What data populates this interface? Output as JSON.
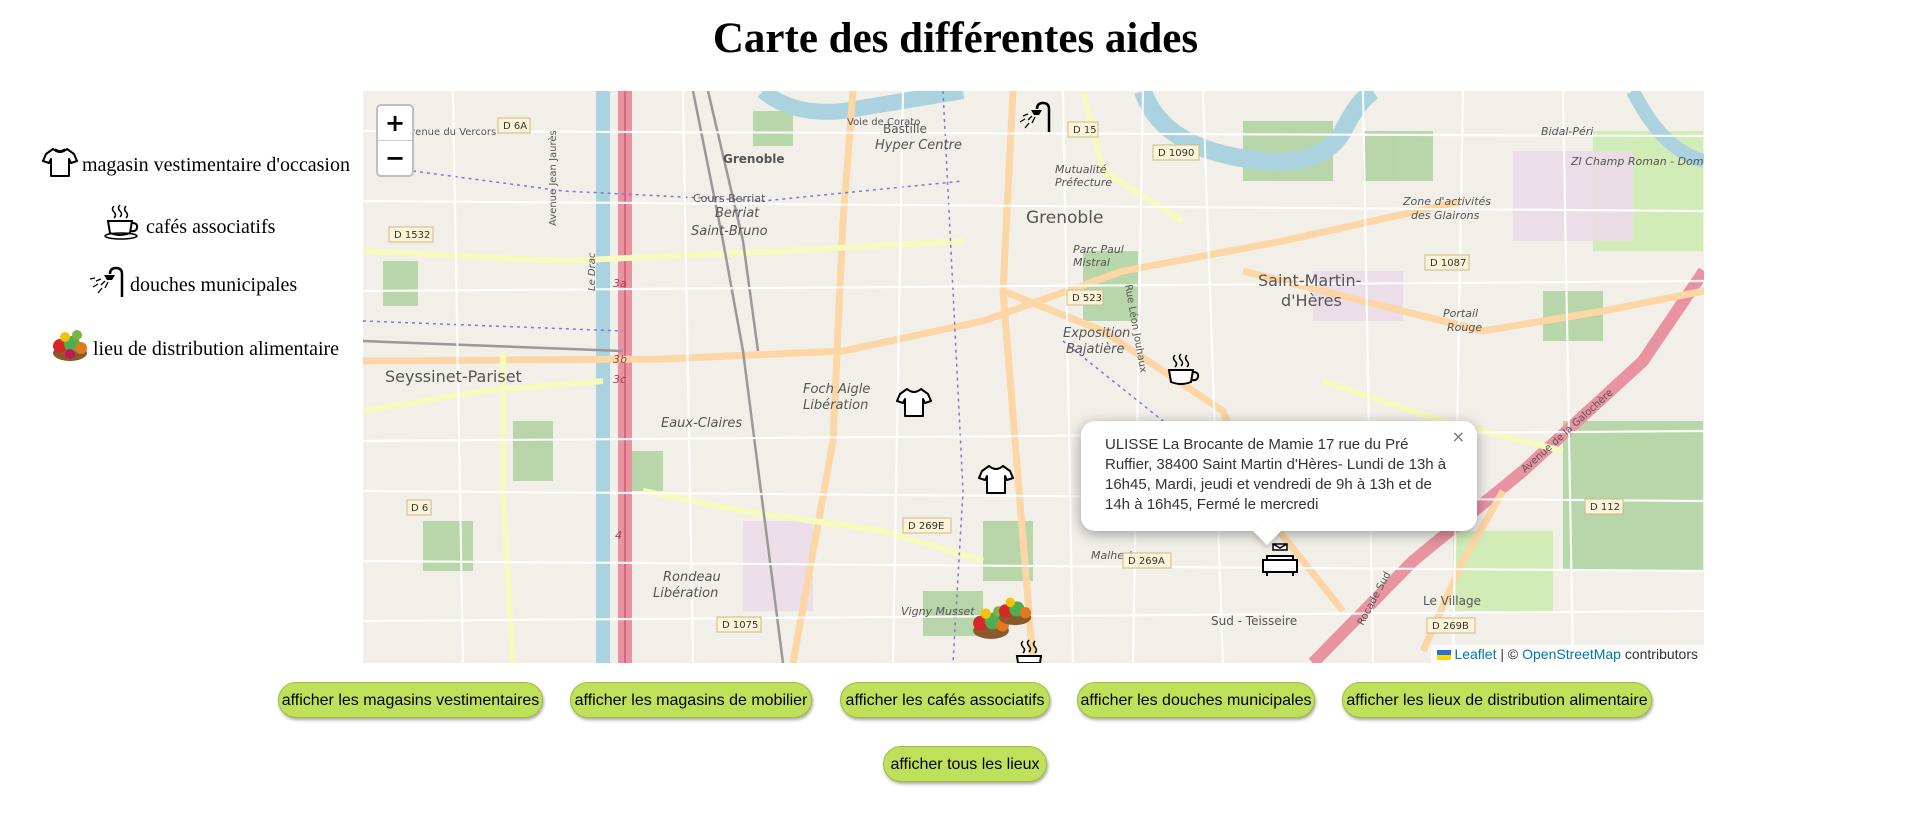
{
  "title": "Carte des différentes aides",
  "legend": [
    {
      "icon": "tshirt-icon",
      "label": "magasin vestimentaire d'occasion"
    },
    {
      "icon": "coffee-cup-icon",
      "label": "cafés associatifs"
    },
    {
      "icon": "shower-icon",
      "label": "douches municipales"
    },
    {
      "icon": "vegetables-icon",
      "label": "lieu de distribution alimentaire"
    }
  ],
  "map": {
    "zoom_in": "+",
    "zoom_out": "−",
    "labels": {
      "grenoble": "Grenoble",
      "saint_martin_1": "Saint-Martin-",
      "saint_martin_2": "d'Hères",
      "seyssinet": "Seyssinet-Pariset",
      "hyper_centre": "Hyper Centre",
      "bastille": "Bastille",
      "berriat_1": "Berriat",
      "berriat_2": "Saint-Bruno",
      "eaux_claires": "Eaux-Claires",
      "foch_1": "Foch Aigle",
      "foch_2": "Libération",
      "exposition_1": "Exposition",
      "exposition_2": "Bajatière",
      "rondeau_1": "Rondeau",
      "rondeau_2": "Libération",
      "parc_1": "Parc Paul",
      "parc_2": "Mistral",
      "portail_1": "Portail",
      "portail_2": "Rouge",
      "zone_1": "Zone d'activités",
      "zone_2": "des Glairons",
      "mutualite_1": "Mutualité",
      "mutualite_2": "Préfecture",
      "sud_teisseire": "Sud - Teisseire",
      "le_village": "Le Village",
      "zi": "ZI Champ Roman - Domai",
      "malherbe": "Malherbe",
      "vigny": "Vigny Musset",
      "bidal": "Bidal-Péri",
      "cours_berriat": "Cours Berriat",
      "voie_corato": "Voie de Corato",
      "av_vercors": "Avenue du Vercors",
      "av_jean_jaures": "Avenue Jean Jaurès",
      "rue_leon": "Rue Léon Jouhaux",
      "av_galochere": "Avenue de la Galochère",
      "rocade": "Rocade Sud",
      "le_drac": "Le Drac",
      "roads": [
        "D 6A",
        "D 15",
        "D 1090",
        "D 1532",
        "D 1087",
        "D 523",
        "D 6",
        "D 269E",
        "D 269A",
        "D 112",
        "D 1075",
        "D 269B"
      ],
      "exits": [
        "3a",
        "3b",
        "3c",
        "4"
      ]
    },
    "popup": {
      "text": "ULISSE La Brocante de Mamie 17 rue du Pré Ruffier, 38400 Saint Martin d'Hères- Lundi de 13h à 16h45, Mardi, jeudi et vendredi de 9h à 13h et de 14h à 16h45, Fermé le mercredi",
      "close": "×"
    },
    "attribution": {
      "leaflet": "Leaflet",
      "sep": "| ©",
      "osm": "OpenStreetMap",
      "contributors": "contributors"
    }
  },
  "buttons": [
    "afficher les magasins vestimentaires",
    "afficher les magasins de mobilier",
    "afficher les cafés associatifs",
    "afficher les douches municipales",
    "afficher les lieux de distribution alimentaire",
    "afficher tous les lieux"
  ],
  "colors": {
    "button_bg": "#bfe05a",
    "map_bg": "#f2efe9",
    "motorway": "#e892a2",
    "river": "#aad3df",
    "park": "#add19e",
    "link": "#0078a8"
  }
}
